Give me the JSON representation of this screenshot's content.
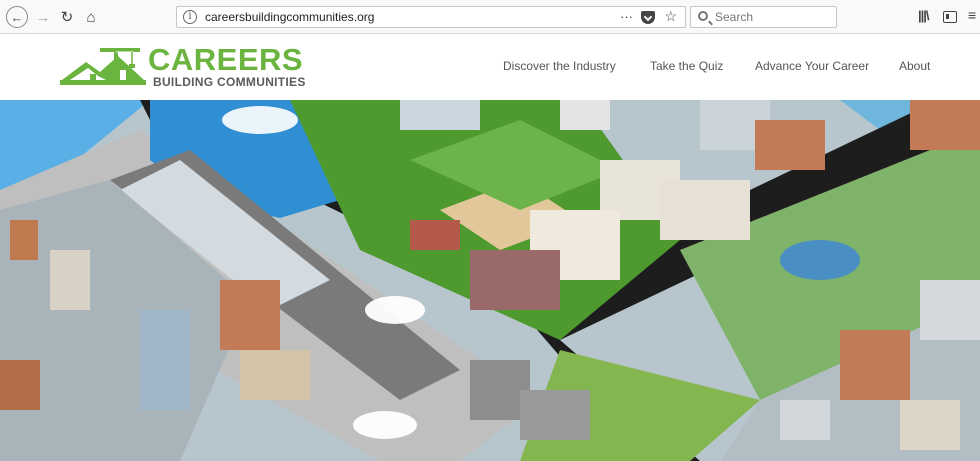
{
  "browser": {
    "url": "careersbuildingcommunities.org",
    "search_placeholder": "Search",
    "icons": {
      "back": "back-arrow-icon",
      "forward": "forward-arrow-icon",
      "reload": "reload-icon",
      "home": "home-icon",
      "info": "info-icon",
      "more": "more-dots-icon",
      "pocket": "pocket-icon",
      "bookmark": "star-icon",
      "search": "search-icon",
      "library": "library-icon",
      "sidebar": "sidebar-icon",
      "menu": "hamburger-icon"
    }
  },
  "site": {
    "logo_title": "CAREERS",
    "logo_subtitle": "BUILDING COMMUNITIES",
    "brand_color": "#6ab43f",
    "nav": [
      {
        "label": "Discover the Industry"
      },
      {
        "label": "Take the Quiz"
      },
      {
        "label": "Advance Your Career"
      },
      {
        "label": "About"
      }
    ]
  },
  "hero": {
    "illustration": "isometric-city-illustration"
  }
}
